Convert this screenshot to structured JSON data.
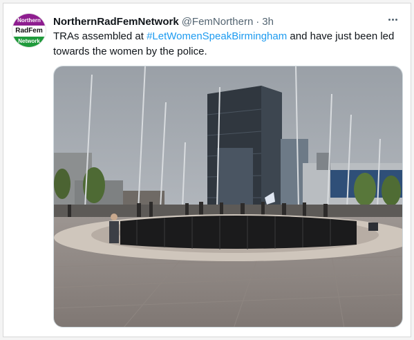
{
  "tweet": {
    "display_name": "NorthernRadFemNetwork",
    "handle": "@FemNorthern",
    "separator": "·",
    "time": "3h",
    "text_before": "TRAs assembled at ",
    "hashtag": "#LetWomenSpeakBirmingham",
    "text_after": " and have just been led towards the women by the police."
  },
  "avatar": {
    "line1": "Northern",
    "line2": "RadFem",
    "line3": "Network",
    "colors": {
      "top": "#8e1d8f",
      "bottom": "#1f9a3b"
    }
  },
  "icons": {
    "more": "more-horizontal-icon"
  },
  "colors": {
    "link": "#1d9bf0",
    "muted": "#536471",
    "text": "#0f1419"
  }
}
